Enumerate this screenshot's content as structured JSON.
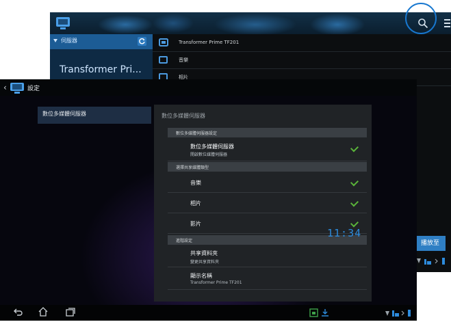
{
  "back_window": {
    "sidebar_header": "伺服器",
    "device_title": "Transformer Pri...",
    "rows": [
      {
        "label": "Transformer Prime TF201",
        "icon": "device-icon"
      },
      {
        "label": "音樂",
        "icon": "folder-icon"
      },
      {
        "label": "相片",
        "icon": "folder-icon"
      }
    ],
    "play_to_button": "播放至"
  },
  "front_window": {
    "title": "設定",
    "left_menu_item": "數位多媒體伺服器",
    "panel_title": "數位多媒體伺服器",
    "sections": [
      {
        "header": "數位多媒體伺服器設定",
        "items": [
          {
            "title": "數位多媒體伺服器",
            "subtitle": "開啟數位媒體伺服器",
            "checked": true
          }
        ]
      },
      {
        "header": "選擇共享媒體類型",
        "items": [
          {
            "title": "音樂",
            "checked": true
          },
          {
            "title": "相片",
            "checked": true
          },
          {
            "title": "影片",
            "checked": true
          }
        ]
      },
      {
        "header": "進階設定",
        "items": [
          {
            "title": "共享資料夾",
            "subtitle": "變更共享資料夾"
          },
          {
            "title": "顯示名稱",
            "subtitle": "Transformer Prime TF201"
          }
        ]
      }
    ],
    "clock": "11:34"
  },
  "colors": {
    "accent": "#2f7fc4",
    "check": "#5ab43a",
    "highlight_circle": "#1878d0"
  }
}
